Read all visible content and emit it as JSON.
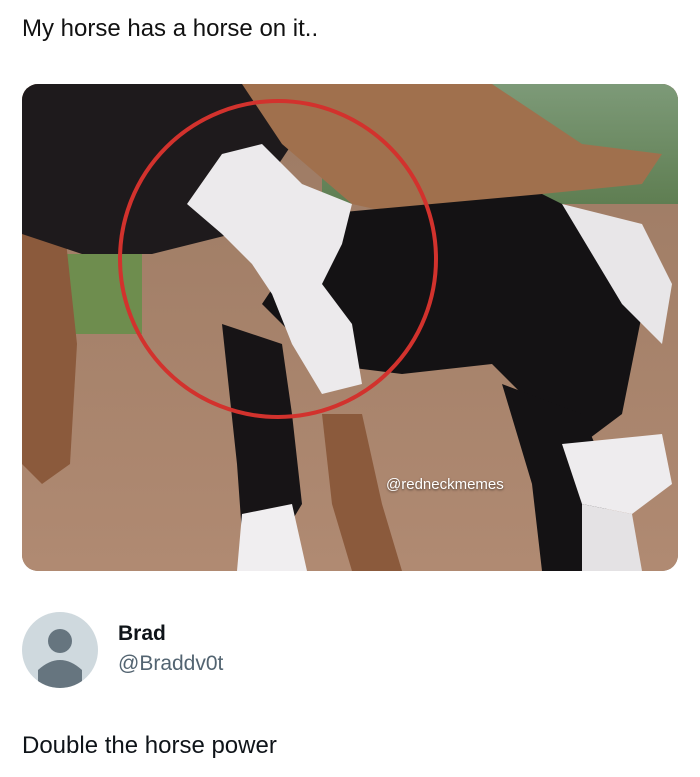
{
  "post": {
    "text": "My horse has a horse on it.."
  },
  "media": {
    "watermark": "@redneckmemes",
    "circle_color": "#d2322d"
  },
  "author": {
    "name": "Brad",
    "handle": "@Braddv0t",
    "avatar_icon": "default-avatar-icon"
  },
  "reply": {
    "text": "Double the horse power"
  },
  "colors": {
    "text_primary": "#0f1419",
    "text_secondary": "#536471",
    "avatar_bg": "#cfd9de"
  }
}
